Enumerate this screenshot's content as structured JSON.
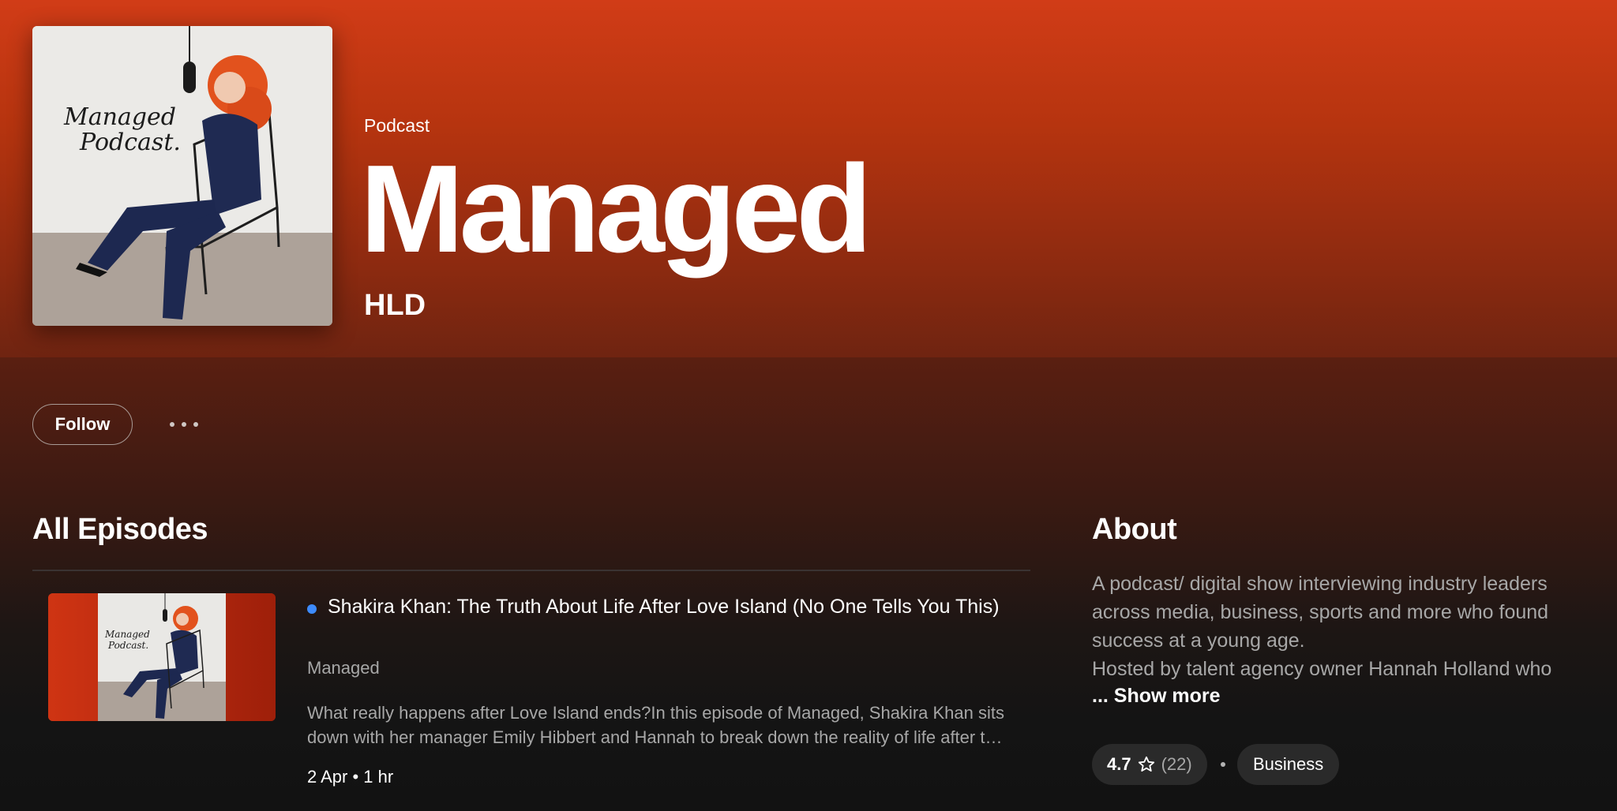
{
  "header": {
    "type_label": "Podcast",
    "title": "Managed",
    "publisher": "HLD",
    "cover_icon": "podcast-cover-art",
    "cover_text": "Managed Podcast."
  },
  "actions": {
    "follow_label": "Follow",
    "more_icon": "ellipsis-icon"
  },
  "episodes": {
    "heading": "All Episodes",
    "items": [
      {
        "title": "Shakira Khan: The Truth About Life After Love Island (No One Tells You This)",
        "show": "Managed",
        "description": "What really happens after Love Island ends?In this episode of Managed, Shakira Khan sits down with her manager Emily Hibbert and Hannah to break down the reality of life after the villa and how to turn short-lived fame into a long-term career.",
        "meta": "2 Apr • 1 hr",
        "new_indicator_color": "#3d8bfd"
      }
    ]
  },
  "about": {
    "heading": "About",
    "text": "A podcast/ digital show interviewing industry leaders across media, business, sports and more who found success at a young age.\nHosted by talent agency owner Hannah Holland who",
    "show_more": "... Show more",
    "rating": {
      "value": "4.7",
      "count": "(22)",
      "icon": "star-outline-icon"
    },
    "category": "Business"
  },
  "colors": {
    "accent": "#d13c17",
    "background": "#121212",
    "new_dot": "#3d8bfd"
  }
}
